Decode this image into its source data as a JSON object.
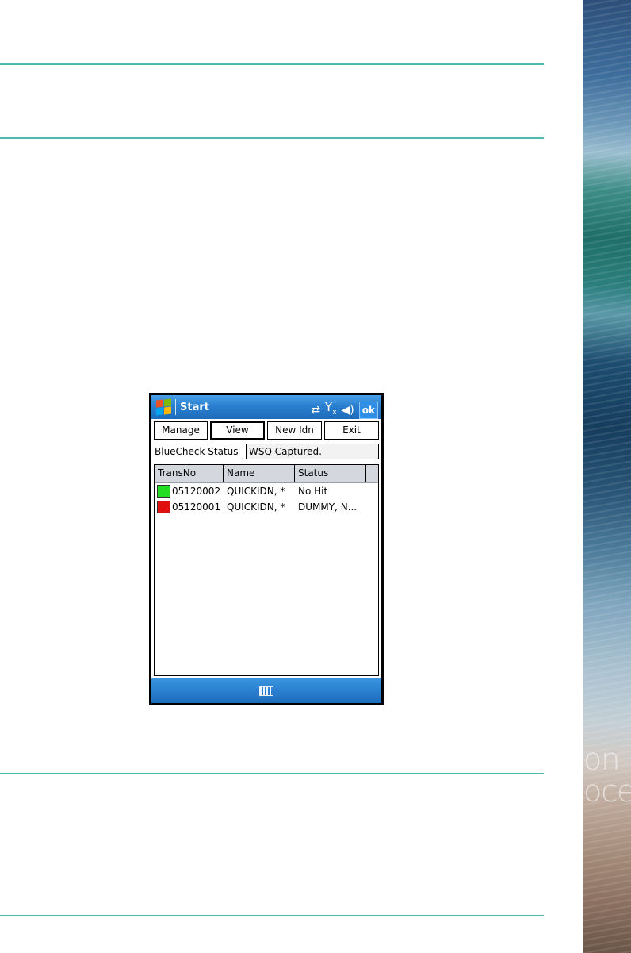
{
  "device": {
    "titlebar": {
      "title": "Start",
      "ok_label": "ok",
      "icons": [
        "windows-logo-icon",
        "connectivity-icon",
        "signal-off-icon",
        "volume-icon"
      ]
    },
    "buttons": {
      "manage": "Manage",
      "view": "View",
      "new_idn": "New Idn",
      "exit": "Exit"
    },
    "status": {
      "label": "BlueCheck Status",
      "value": "WSQ Captured."
    },
    "list": {
      "columns": [
        "TransNo",
        "Name",
        "Status"
      ],
      "rows": [
        {
          "transno": "05120002",
          "name": "QUICKIDN, *",
          "status": "No Hit",
          "color": "#22dd22"
        },
        {
          "transno": "05120001",
          "name": "QUICKIDN, *",
          "status": "DUMMY, N...",
          "color": "#e01010"
        }
      ]
    },
    "bottombar": {
      "icon": "keyboard-icon"
    }
  },
  "decor": {
    "wave_text_1": "on",
    "wave_text_2": "oce"
  },
  "colors": {
    "rule": "#4fb9ae",
    "titlebar": "#2a7fd0"
  }
}
